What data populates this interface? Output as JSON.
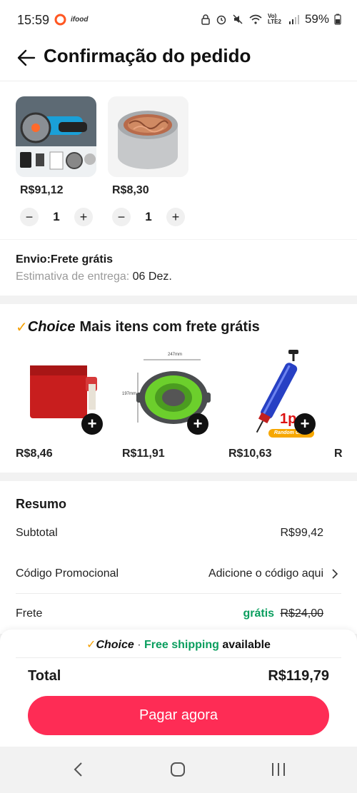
{
  "status_bar": {
    "time": "15:59",
    "carrier_label": "ifood",
    "network": "Vo) LTE2",
    "battery": "59%"
  },
  "header": {
    "title": "Confirmação do pedido"
  },
  "cart": {
    "items": [
      {
        "name": "cordless-angle-grinder",
        "price": "R$91,12",
        "quantity": "1"
      },
      {
        "name": "copper-scrubber-tin",
        "price": "R$8,30",
        "quantity": "1"
      }
    ]
  },
  "shipping": {
    "title": "Envio:Frete grátis",
    "estimate_label": "Estimativa de entrega: ",
    "estimate_date": "06 Dez."
  },
  "choice": {
    "brand": "Choice",
    "heading": "Mais itens com frete grátis",
    "items": [
      {
        "name": "red-toothpaste-squeezer",
        "price": "R$8,46"
      },
      {
        "name": "collapsible-green-colander",
        "price": "R$11,91",
        "dim_w": "247mm",
        "dim_h": "197mm"
      },
      {
        "name": "blue-hand-pump",
        "price": "R$10,63",
        "badge": "1p",
        "tag": "Random Color"
      },
      {
        "name": "partial-item",
        "price": "R"
      }
    ]
  },
  "summary": {
    "title": "Resumo",
    "subtotal_label": "Subtotal",
    "subtotal_value": "R$99,42",
    "promo_label": "Código Promocional",
    "promo_value": "Adicione o código aqui",
    "shipping_label": "Frete",
    "shipping_free": "grátis",
    "shipping_old": "R$24,00"
  },
  "choice_bar": {
    "brand": "Choice",
    "sep": " · ",
    "free": "Free shipping",
    "available": " available"
  },
  "total": {
    "label": "Total",
    "value": "R$119,79"
  },
  "pay_button": "Pagar agora",
  "colors": {
    "accent": "#fe2c55",
    "free_green": "#0a9e5e",
    "choice_orange": "#f5a000"
  }
}
